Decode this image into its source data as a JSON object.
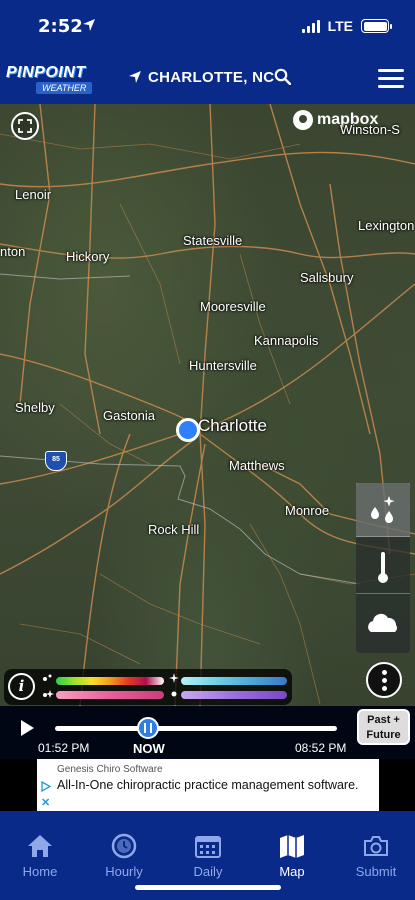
{
  "status_bar": {
    "time": "2:52",
    "network": "LTE"
  },
  "header": {
    "logo_top": "PINPOINT",
    "logo_bottom": "WEATHER",
    "city": "CHARLOTTE, NC"
  },
  "map": {
    "attribution": "mapbox",
    "labels": {
      "winston": "Winston-S",
      "lenoir": "Lenoir",
      "lexington": "Lexington",
      "statesville": "Statesville",
      "hickory": "Hickory",
      "nton": "nton",
      "salisbury": "Salisbury",
      "mooresville": "Mooresville",
      "kannapolis": "Kannapolis",
      "huntersville": "Huntersville",
      "shelby": "Shelby",
      "gastonia": "Gastonia",
      "charlotte": "Charlotte",
      "matthews": "Matthews",
      "monroe": "Monroe",
      "rock_hill": "Rock Hill"
    },
    "interstate": "85",
    "layers": [
      "precip-icon",
      "thermometer-icon",
      "cloud-icon"
    ]
  },
  "timeline": {
    "start_time": "01:52 PM",
    "now_label": "NOW",
    "end_time": "08:52 PM",
    "past_future": "Past + Future",
    "progress": 0.33
  },
  "ad": {
    "sponsor": "Genesis Chiro Software",
    "text": "All-In-One chiropractic practice management software."
  },
  "tabs": [
    {
      "label": "Home",
      "icon": "home-icon",
      "active": false
    },
    {
      "label": "Hourly",
      "icon": "clock-icon",
      "active": false
    },
    {
      "label": "Daily",
      "icon": "calendar-icon",
      "active": false
    },
    {
      "label": "Map",
      "icon": "map-icon",
      "active": true
    },
    {
      "label": "Submit",
      "icon": "camera-icon",
      "active": false
    }
  ],
  "colors": {
    "brand": "#0a2a8a",
    "accent": "#2f80ff"
  }
}
